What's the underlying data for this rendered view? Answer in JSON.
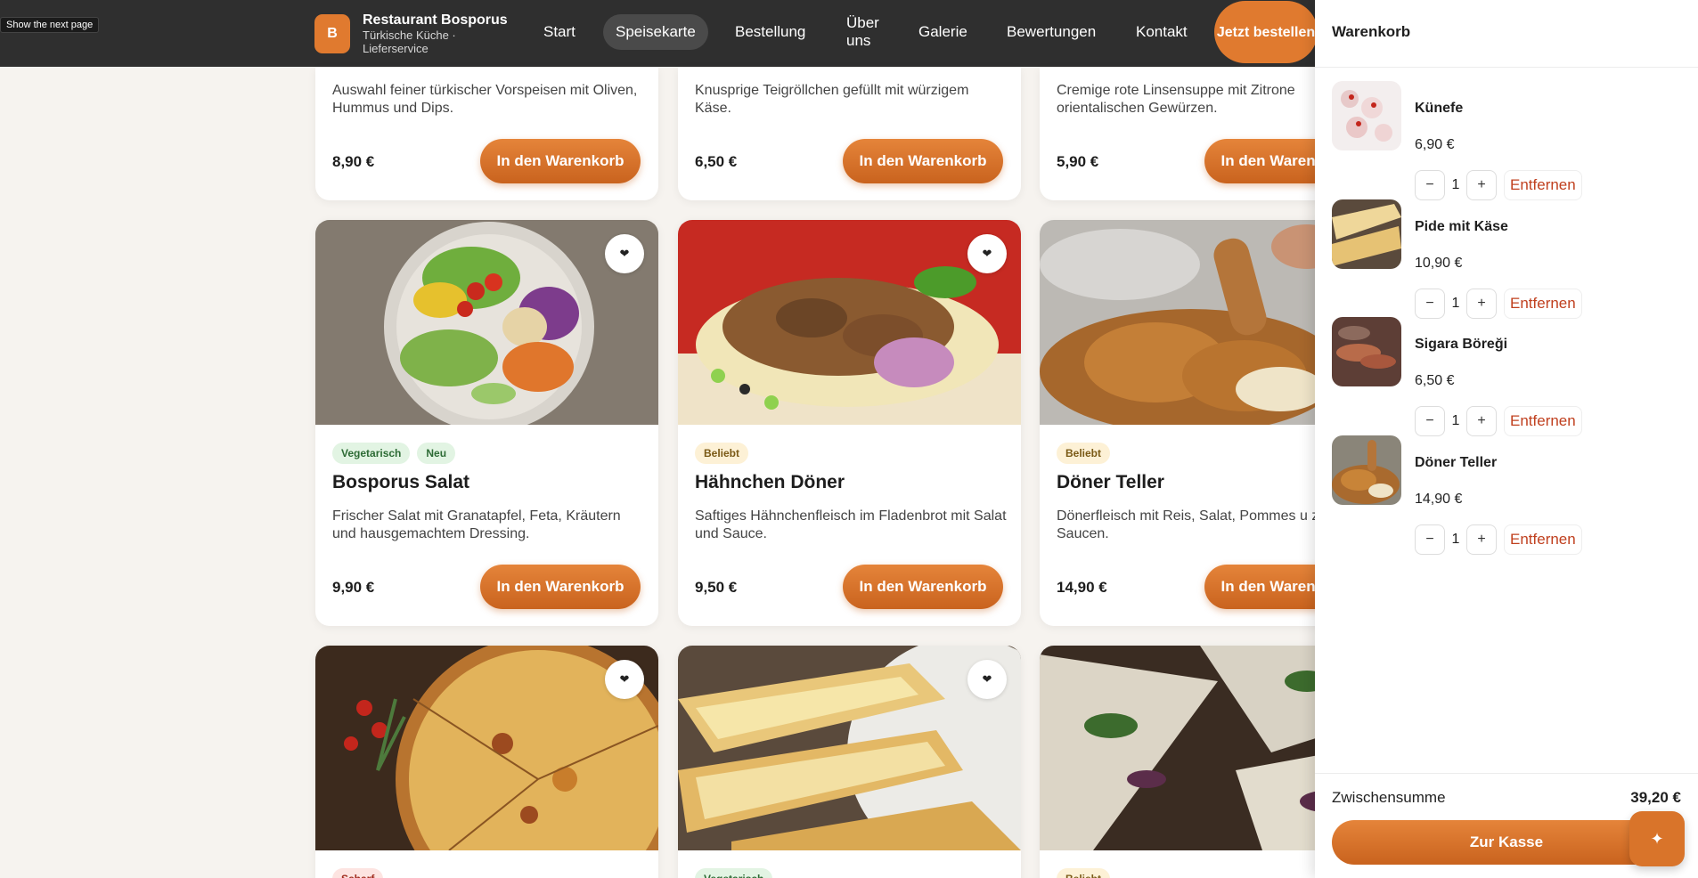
{
  "tooltip": "Show the next page",
  "brand": {
    "logo_letter": "B",
    "name": "Restaurant Bosporus",
    "subtitle": "Türkische Küche · Lieferservice"
  },
  "nav": {
    "items": [
      "Start",
      "Speisekarte",
      "Bestellung",
      "Über uns",
      "Galerie",
      "Bewertungen",
      "Kontakt"
    ],
    "active": "Speisekarte",
    "cta": "Jetzt bestellen"
  },
  "menu": {
    "add_label": "In den Warenkorb",
    "row1": [
      {
        "desc": "Auswahl feiner türkischer Vorspeisen mit Oliven, Hummus und Dips.",
        "price": "8,90 €"
      },
      {
        "desc": "Knusprige Teigröllchen gefüllt mit würzigem Käse.",
        "price": "6,50 €"
      },
      {
        "desc": "Cremige rote Linsensuppe mit Zitrone orientalischen Gewürzen.",
        "price": "5,90 €"
      }
    ],
    "row2": [
      {
        "badges": [
          "Vegetarisch",
          "Neu"
        ],
        "title": "Bosporus Salat",
        "desc": "Frischer Salat mit Granatapfel, Feta, Kräutern und hausgemachtem Dressing.",
        "price": "9,90 €"
      },
      {
        "badges": [
          "Beliebt"
        ],
        "title": "Hähnchen Döner",
        "desc": "Saftiges Hähnchenfleisch im Fladenbrot mit Salat und Sauce.",
        "price": "9,50 €"
      },
      {
        "badges": [
          "Beliebt"
        ],
        "title": "Döner Teller",
        "desc": "Dönerfleisch mit Reis, Salat, Pommes u zwei Saucen.",
        "price": "14,90 €"
      }
    ],
    "row3": [
      {
        "badges": [
          "Scharf"
        ]
      },
      {
        "badges": [
          "Vegetarisch"
        ]
      },
      {
        "badges": [
          "Beliebt"
        ]
      }
    ]
  },
  "cart": {
    "title": "Warenkorb",
    "items": [
      {
        "name": "Künefe",
        "price": "6,90 €",
        "qty": "1"
      },
      {
        "name": "Pide mit Käse",
        "price": "10,90 €",
        "qty": "1"
      },
      {
        "name": "Sigara Böreği",
        "price": "6,50 €",
        "qty": "1"
      },
      {
        "name": "Döner Teller",
        "price": "14,90 €",
        "qty": "1"
      }
    ],
    "minus": "−",
    "plus": "+",
    "remove_label": "Entfernen",
    "subtotal_label": "Zwischensumme",
    "subtotal_value": "39,20 €",
    "checkout_label": "Zur Kasse"
  },
  "icons": {
    "favorite": "heart-icon",
    "assistant": "sparkle-icon"
  },
  "colors": {
    "accent": "#e07a2f",
    "header": "#2f2f2f",
    "remove": "#c0401f"
  }
}
